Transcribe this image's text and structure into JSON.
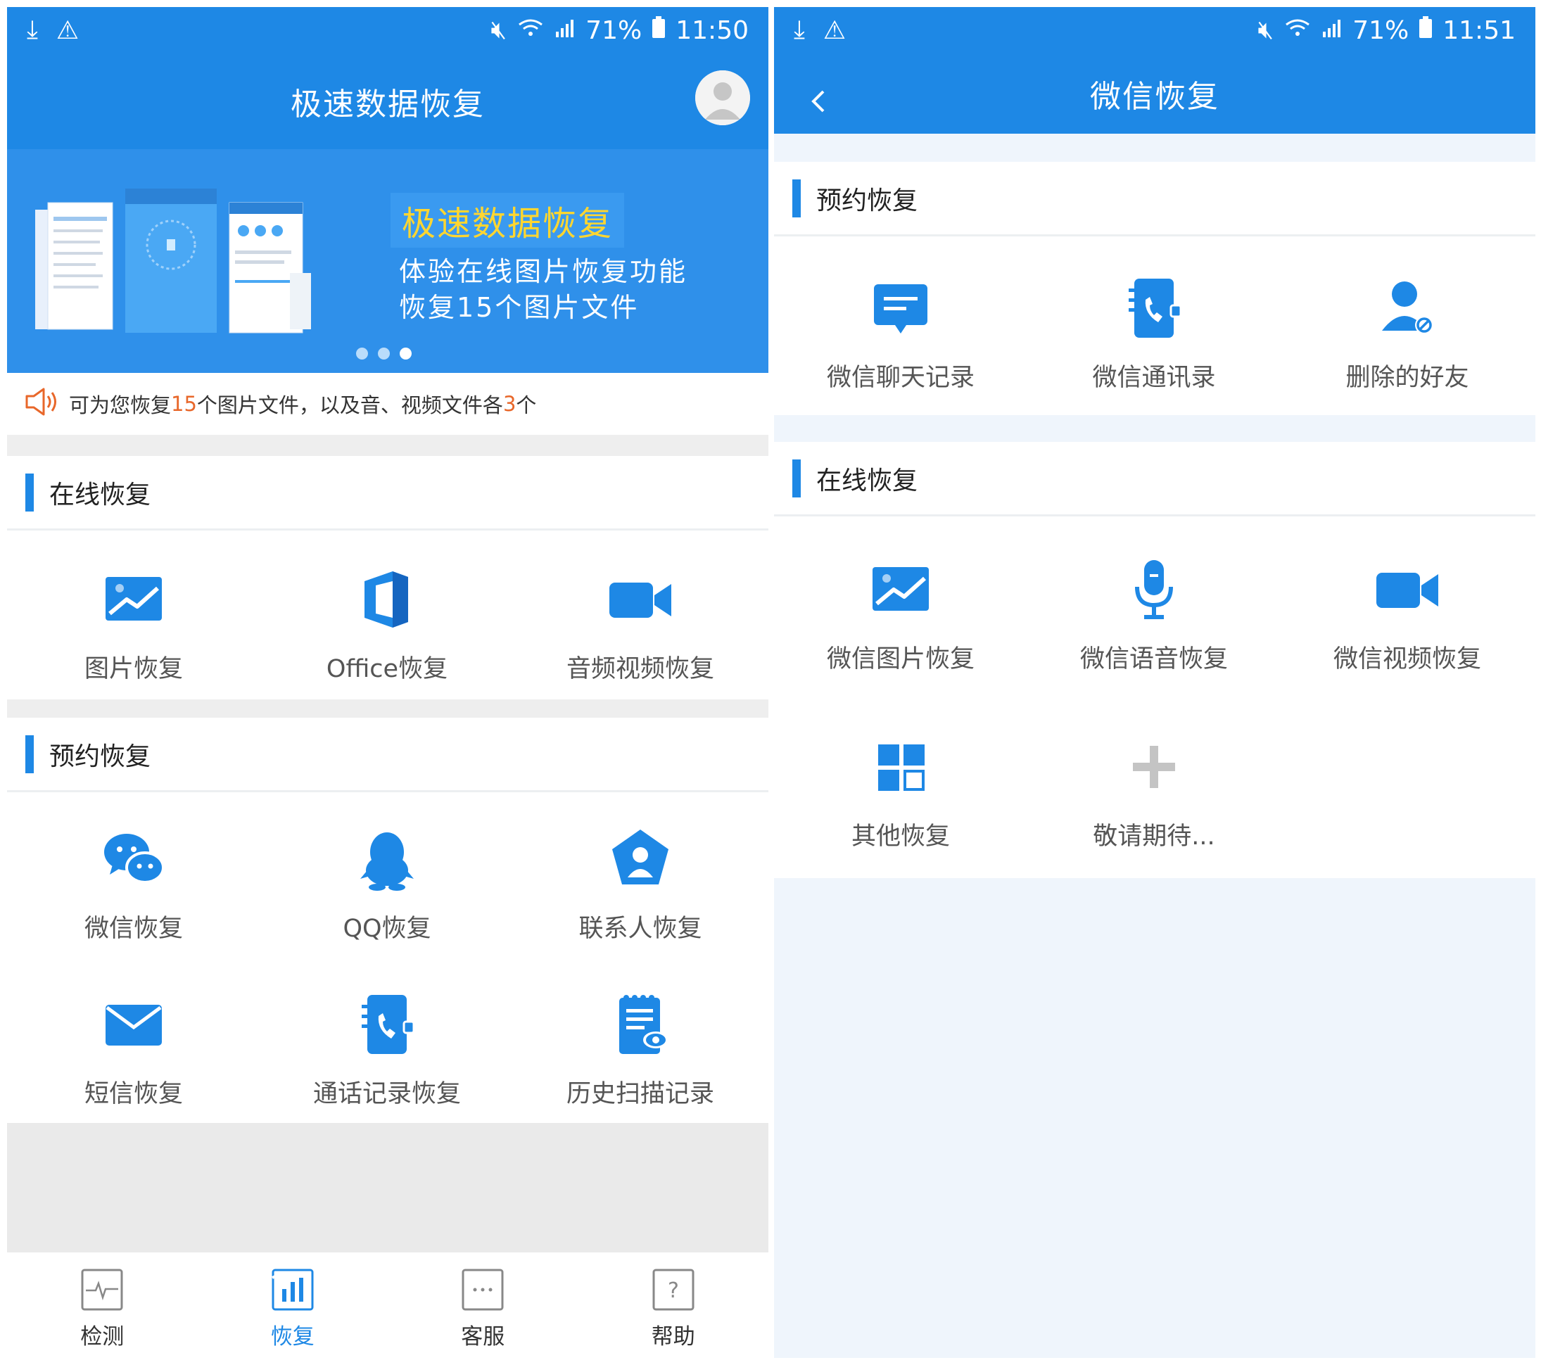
{
  "left": {
    "status": {
      "time": "11:50",
      "battery": "71%"
    },
    "title": "极速数据恢复",
    "banner": {
      "headline": "极速数据恢复",
      "line1": "体验在线图片恢复功能",
      "line2": "恢复15个图片文件",
      "page_count": 3,
      "active_page": 3
    },
    "notice": {
      "p1": "可为您恢复",
      "n1": "15",
      "p2": "个图片文件，以及音、视频文件各",
      "n2": "3",
      "p3": "个"
    },
    "online": {
      "heading": "在线恢复",
      "items": [
        {
          "label": "图片恢复",
          "icon": "image-icon"
        },
        {
          "label": "Office恢复",
          "icon": "office-icon"
        },
        {
          "label": "音频视频恢复",
          "icon": "video-camera-icon"
        }
      ]
    },
    "reserve": {
      "heading": "预约恢复",
      "items": [
        {
          "label": "微信恢复",
          "icon": "wechat-icon"
        },
        {
          "label": "QQ恢复",
          "icon": "qq-penguin-icon"
        },
        {
          "label": "联系人恢复",
          "icon": "contact-icon"
        },
        {
          "label": "短信恢复",
          "icon": "envelope-icon"
        },
        {
          "label": "通话记录恢复",
          "icon": "phone-book-icon"
        },
        {
          "label": "历史扫描记录",
          "icon": "scan-history-icon"
        }
      ]
    },
    "tabs": [
      {
        "label": "检测",
        "icon": "pulse-icon",
        "active": false
      },
      {
        "label": "恢复",
        "icon": "bar-chart-icon",
        "active": true
      },
      {
        "label": "客服",
        "icon": "chat-dots-icon",
        "active": false
      },
      {
        "label": "帮助",
        "icon": "question-icon",
        "active": false
      }
    ]
  },
  "right": {
    "status": {
      "time": "11:51",
      "battery": "71%"
    },
    "title": "微信恢复",
    "reserve": {
      "heading": "预约恢复",
      "items": [
        {
          "label": "微信聊天记录",
          "icon": "chat-bubble-icon"
        },
        {
          "label": "微信通讯录",
          "icon": "phone-book-icon"
        },
        {
          "label": "删除的好友",
          "icon": "deleted-friend-icon"
        }
      ]
    },
    "online": {
      "heading": "在线恢复",
      "items": [
        {
          "label": "微信图片恢复",
          "icon": "image-icon"
        },
        {
          "label": "微信语音恢复",
          "icon": "microphone-icon"
        },
        {
          "label": "微信视频恢复",
          "icon": "video-camera-icon"
        },
        {
          "label": "其他恢复",
          "icon": "grid-icon"
        },
        {
          "label": "敬请期待...",
          "icon": "plus-icon"
        }
      ]
    }
  },
  "colors": {
    "primary": "#1e88e5",
    "banner": "#2f90ea",
    "highlight": "#ffd630",
    "accent_number": "#e8672a"
  }
}
